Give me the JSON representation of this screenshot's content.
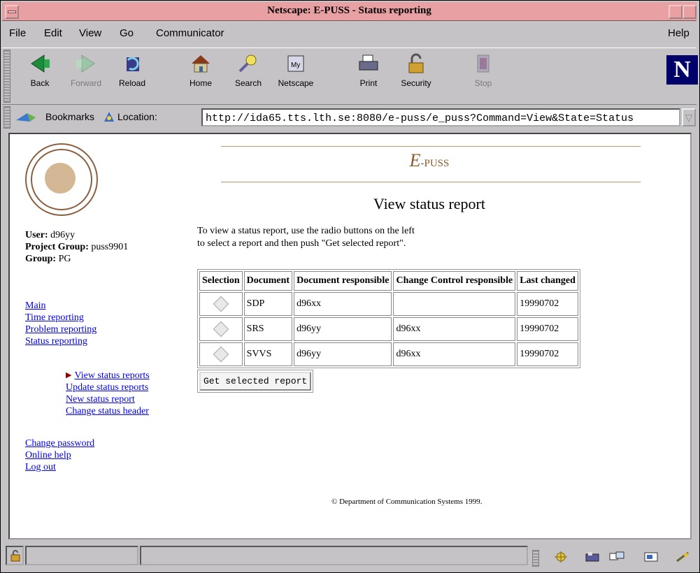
{
  "window": {
    "title": "Netscape: E-PUSS - Status reporting"
  },
  "menu": {
    "items": [
      "File",
      "Edit",
      "View",
      "Go",
      "Communicator"
    ],
    "help": "Help"
  },
  "toolbar": {
    "buttons": [
      {
        "label": "Back",
        "icon": "back-arrow-icon"
      },
      {
        "label": "Forward",
        "icon": "forward-arrow-icon"
      },
      {
        "label": "Reload",
        "icon": "reload-icon"
      },
      {
        "label": "Home",
        "icon": "home-icon"
      },
      {
        "label": "Search",
        "icon": "search-icon"
      },
      {
        "label": "Netscape",
        "icon": "netscape-icon"
      },
      {
        "label": "Print",
        "icon": "print-icon"
      },
      {
        "label": "Security",
        "icon": "security-lock-icon"
      },
      {
        "label": "Stop",
        "icon": "stop-icon"
      }
    ],
    "logo": "N"
  },
  "location": {
    "bookmarks_label": "Bookmarks",
    "location_label": "Location:",
    "url": "http://ida65.tts.lth.se:8080/e-puss/e_puss?Command=View&State=Status"
  },
  "sidebar": {
    "user_label": "User:",
    "user_value": "d96yy",
    "group_label": "Project Group:",
    "group_value": "puss9901",
    "role_label": "Group:",
    "role_value": "PG",
    "nav": [
      "Main",
      "Time reporting",
      "Problem reporting",
      "Status reporting"
    ],
    "subnav": [
      "View status reports",
      "Update status reports",
      "New status report",
      "Change status header"
    ],
    "account": [
      "Change password",
      "Online help",
      "Log out"
    ]
  },
  "main": {
    "brand_big": "E",
    "brand_small": "-PUSS",
    "heading": "View status report",
    "intro_line1": "To view a status report, use the radio buttons on the left",
    "intro_line2": "to select a report and then push \"Get selected report\".",
    "table": {
      "headers": [
        "Selection",
        "Document",
        "Document responsible",
        "Change Control responsible",
        "Last changed"
      ],
      "rows": [
        {
          "document": "SDP",
          "doc_resp": "d96xx",
          "cc_resp": "",
          "changed": "19990702"
        },
        {
          "document": "SRS",
          "doc_resp": "d96yy",
          "cc_resp": "d96xx",
          "changed": "19990702"
        },
        {
          "document": "SVVS",
          "doc_resp": "d96yy",
          "cc_resp": "d96xx",
          "changed": "19990702"
        }
      ]
    },
    "button": "Get selected report",
    "footer": "© Department of Communication Systems 1999."
  },
  "colors": {
    "titlebar": "#e8a0a3",
    "link": "#0000ee",
    "brand": "#8b5a2b",
    "rule": "#c4956a"
  }
}
